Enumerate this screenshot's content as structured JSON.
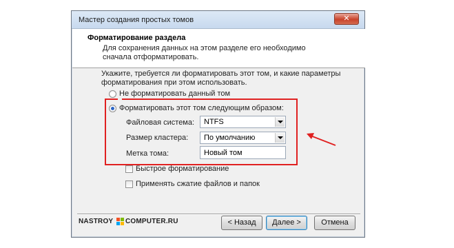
{
  "window": {
    "title": "Мастер создания простых томов",
    "close_label": "✕"
  },
  "header": {
    "title": "Форматирование раздела",
    "description": "Для сохранения данных на этом разделе его необходимо сначала отформатировать."
  },
  "prompt": "Укажите, требуется ли форматировать этот том, и какие параметры форматирования при этом использовать.",
  "options": {
    "no_format_label": "Не форматировать данный том",
    "no_format_checked": false,
    "format_label": "Форматировать этот том следующим образом:",
    "format_checked": true
  },
  "fields": {
    "filesystem_label": "Файловая система:",
    "filesystem_value": "NTFS",
    "cluster_label": "Размер кластера:",
    "cluster_value": "По умолчанию",
    "volume_label_label": "Метка тома:",
    "volume_label_value": "Новый том"
  },
  "checkboxes": {
    "quick_format_label": "Быстрое форматирование",
    "quick_format_checked": false,
    "compression_label": "Применять сжатие файлов и папок",
    "compression_checked": false
  },
  "brand": {
    "part1": "NASTROY",
    "part2": "COMPUTER.RU",
    "logo_colors": [
      "#f25022",
      "#7fba00",
      "#00a4ef",
      "#ffb900"
    ]
  },
  "buttons": {
    "back_label": "< Назад",
    "next_label": "Далее >",
    "cancel_label": "Отмена"
  },
  "annotation": {
    "highlight_color": "#e02020"
  }
}
